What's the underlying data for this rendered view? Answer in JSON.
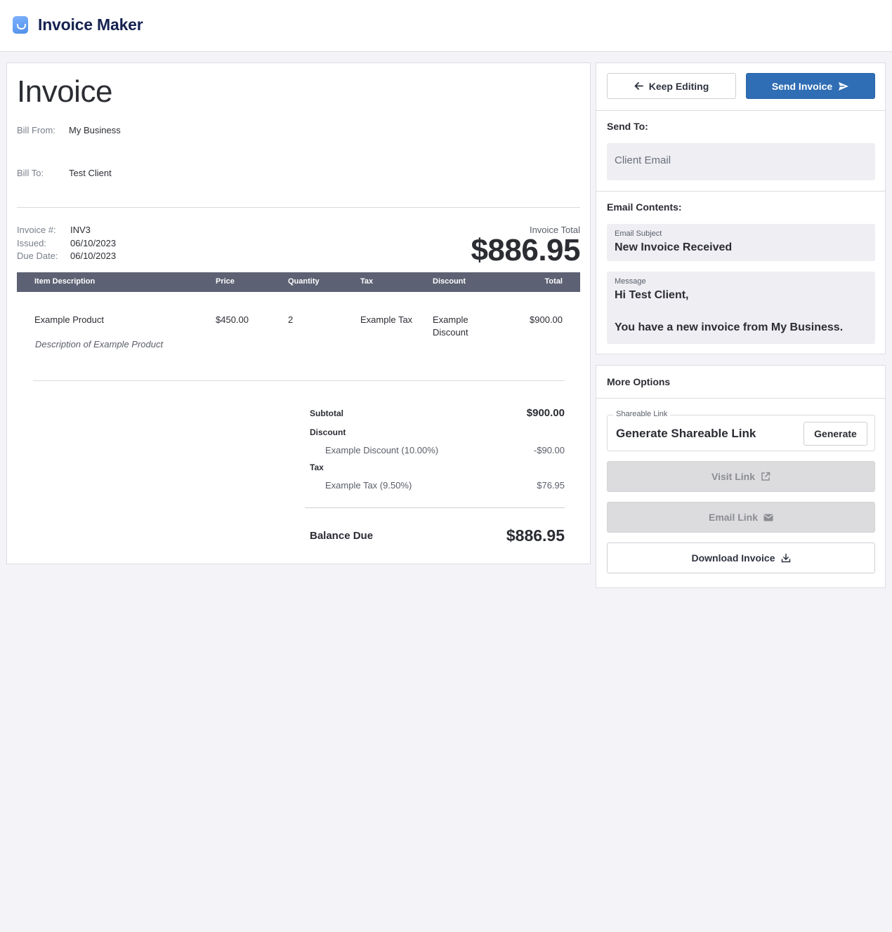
{
  "app": {
    "title": "Invoice Maker"
  },
  "invoice": {
    "heading": "Invoice",
    "bill_from_label": "Bill From:",
    "bill_from_value": "My Business",
    "bill_to_label": "Bill To:",
    "bill_to_value": "Test Client",
    "number_label": "Invoice #:",
    "number_value": "INV3",
    "issued_label": "Issued:",
    "issued_value": "06/10/2023",
    "due_label": "Due Date:",
    "due_value": "06/10/2023",
    "total_label": "Invoice Total",
    "total_value": "$886.95",
    "table": {
      "headers": [
        "Item Description",
        "Price",
        "Quantity",
        "Tax",
        "Discount",
        "Total"
      ],
      "rows": [
        {
          "description": "Example Product",
          "price": "$450.00",
          "quantity": "2",
          "tax": "Example Tax",
          "discount_line1": "Example",
          "discount_line2": "Discount",
          "total": "$900.00",
          "subtext": "Description of Example Product"
        }
      ]
    },
    "summary": {
      "subtotal_label": "Subtotal",
      "subtotal_value": "$900.00",
      "discount_label": "Discount",
      "discount_item_label": "Example Discount (10.00%)",
      "discount_item_value": "-$90.00",
      "tax_label": "Tax",
      "tax_item_label": "Example Tax (9.50%)",
      "tax_item_value": "$76.95",
      "balance_label": "Balance Due",
      "balance_value": "$886.95"
    }
  },
  "actions": {
    "keep_editing": "Keep Editing",
    "send_invoice": "Send Invoice"
  },
  "send_to": {
    "title": "Send To:",
    "email_placeholder": "Client Email"
  },
  "email_contents": {
    "title": "Email Contents:",
    "subject_label": "Email Subject",
    "subject_value": "New Invoice Received",
    "message_label": "Message",
    "message_line1": "Hi Test Client,",
    "message_line2": "You have a new invoice from My Business."
  },
  "more_options": {
    "title": "More Options",
    "link_legend": "Shareable Link",
    "link_text": "Generate Shareable Link",
    "generate": "Generate",
    "visit_link": "Visit Link",
    "email_link": "Email Link",
    "download": "Download Invoice"
  },
  "colors": {
    "primary": "#2f6db5",
    "table_header": "#5c6173",
    "brand_title": "#152250"
  }
}
